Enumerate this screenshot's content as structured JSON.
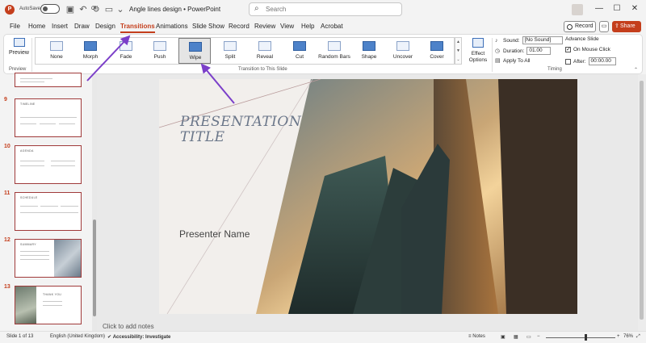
{
  "titlebar": {
    "autosave_label": "AutoSave",
    "toggle_state": "Off",
    "doc_title": "Angle lines design  •  PowerPoint",
    "search_placeholder": "Search"
  },
  "tabs": [
    "File",
    "Home",
    "Insert",
    "Draw",
    "Design",
    "Transitions",
    "Animations",
    "Slide Show",
    "Record",
    "Review",
    "View",
    "Help",
    "Acrobat"
  ],
  "active_tab": "Transitions",
  "header_buttons": {
    "record": "Record",
    "share": "Share"
  },
  "ribbon": {
    "preview_label": "Preview",
    "preview_group": "Preview",
    "gallery_group": "Transition to This Slide",
    "effects": [
      "None",
      "Morph",
      "Fade",
      "Push",
      "Wipe",
      "Split",
      "Reveal",
      "Cut",
      "Random Bars",
      "Shape",
      "Uncover",
      "Cover"
    ],
    "selected_effect": "Wipe",
    "effect_options_label": "Effect Options",
    "timing_group": "Timing",
    "sound_label": "Sound:",
    "sound_value": "[No Sound]",
    "duration_label": "Duration:",
    "duration_value": "01.00",
    "apply_to_all": "Apply To All",
    "advance_slide": "Advance Slide",
    "on_mouse_click": "On Mouse Click",
    "on_mouse_click_checked": true,
    "after_label": "After:",
    "after_value": "00:00.00",
    "after_checked": false
  },
  "thumbnails": [
    {
      "number": "9",
      "heading": "TIMELINE"
    },
    {
      "number": "10",
      "heading": "AGENDA"
    },
    {
      "number": "11",
      "heading": "SCHEDULE"
    },
    {
      "number": "12",
      "heading": "SUMMARY"
    },
    {
      "number": "13",
      "heading": "THANK YOU"
    }
  ],
  "slide": {
    "title": "PRESENTATION TITLE",
    "presenter": "Presenter Name"
  },
  "notes_hint": "Click to add notes",
  "statusbar": {
    "slide_count": "Slide 1 of 13",
    "language": "English (United Kingdom)",
    "accessibility": "Accessibility: Investigate",
    "notes": "Notes",
    "zoom": "76%"
  },
  "colors": {
    "accent": "#c43e1c",
    "annotation_arrow": "#7b3fc9"
  }
}
